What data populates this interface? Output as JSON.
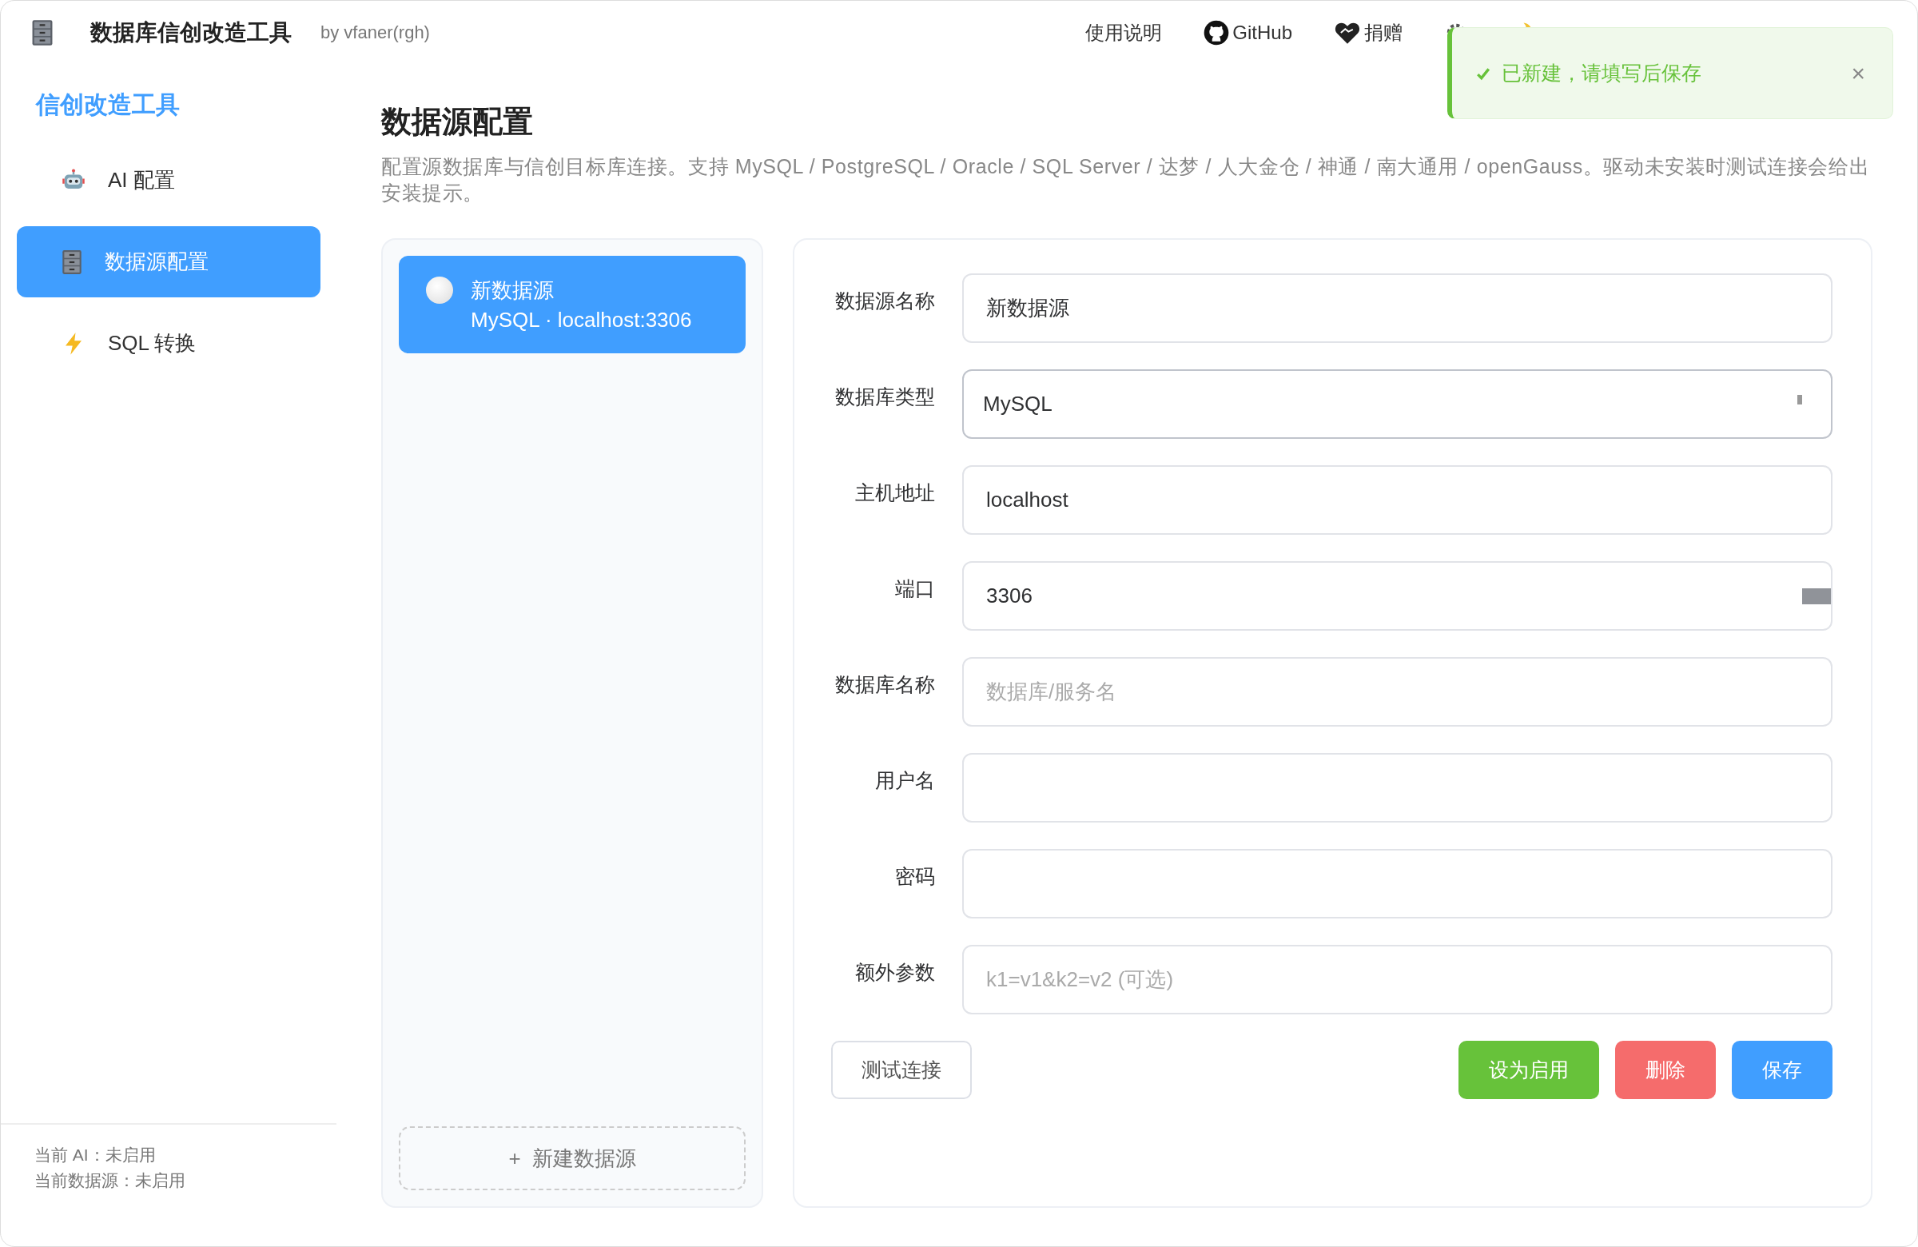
{
  "header": {
    "title": "数据库信创改造工具",
    "byline": "by vfaner(rgh)",
    "nav": [
      {
        "kind": "text",
        "label": "使用说明"
      },
      {
        "kind": "github",
        "label": "GitHub"
      },
      {
        "kind": "donate",
        "label": "捐赠"
      },
      {
        "kind": "settings"
      },
      {
        "kind": "theme"
      }
    ]
  },
  "toast": {
    "kind": "success",
    "message": "已新建，请填写后保存",
    "close": "×"
  },
  "sidebar": {
    "brand": "信创改造工具",
    "items": [
      {
        "label": "AI 配置",
        "selected": false
      },
      {
        "label": "数据源配置",
        "selected": true
      },
      {
        "label": "SQL 转换",
        "selected": false
      }
    ],
    "status": [
      "当前 AI：未启用",
      "当前数据源：未启用"
    ]
  },
  "page": {
    "title": "数据源配置",
    "description": "配置源数据库与信创目标库连接。支持 MySQL / PostgreSQL / Oracle / SQL Server / 达梦 / 人大金仓 / 神通 / 南大通用 / openGauss。驱动未安装时测试连接会给出安装提示。"
  },
  "datasources": [
    {
      "name": "新数据源",
      "subtitle": "MySQL · localhost:3306",
      "selected": true,
      "active": false
    }
  ],
  "add_button": {
    "icon": "+",
    "label": "新建数据源"
  },
  "form": {
    "fields": [
      {
        "kind": "text",
        "label": "数据源名称",
        "value": "新数据源"
      },
      {
        "kind": "select",
        "label": "数据库类型",
        "value": "MySQL"
      },
      {
        "kind": "text",
        "label": "主机地址",
        "value": "localhost"
      },
      {
        "kind": "number",
        "label": "端口",
        "value": "3306"
      },
      {
        "kind": "text",
        "label": "数据库名称",
        "placeholder": "数据库/服务名"
      },
      {
        "kind": "text",
        "label": "用户名"
      },
      {
        "kind": "password",
        "label": "密码"
      },
      {
        "kind": "text",
        "label": "额外参数",
        "placeholder": "k1=v1&k2=v2 (可选)"
      }
    ],
    "buttons": [
      {
        "kind": "default",
        "label": "测试连接"
      },
      {
        "kind": "success",
        "label": "设为启用"
      },
      {
        "kind": "danger",
        "label": "删除"
      },
      {
        "kind": "primary",
        "label": "保存"
      }
    ]
  }
}
